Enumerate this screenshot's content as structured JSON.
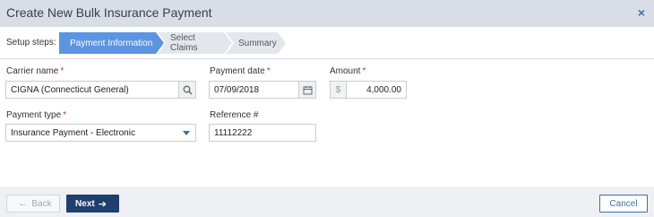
{
  "dialog": {
    "title": "Create New Bulk Insurance Payment",
    "close_glyph": "×"
  },
  "steps": {
    "label": "Setup steps:",
    "items": [
      {
        "label": "Payment Information",
        "state": "active"
      },
      {
        "label": "Select Claims",
        "state": "inactive"
      },
      {
        "label": "Summary",
        "state": "inactive"
      }
    ]
  },
  "form": {
    "carrier": {
      "label": "Carrier name",
      "required_mark": "*",
      "value": "CIGNA (Connecticut General)",
      "icon": "search-icon"
    },
    "payment_date": {
      "label": "Payment date",
      "required_mark": "*",
      "value": "07/09/2018",
      "icon": "calendar-icon"
    },
    "amount": {
      "label": "Amount",
      "required_mark": "*",
      "prefix": "$",
      "value": "4,000.00"
    },
    "payment_type": {
      "label": "Payment type",
      "required_mark": "*",
      "value": "Insurance Payment - Electronic",
      "icon": "chevron-down-icon"
    },
    "reference": {
      "label": "Reference #",
      "value": "11112222"
    }
  },
  "footer": {
    "back_label": "Back",
    "back_glyph": "←",
    "next_label": "Next",
    "next_glyph": "➔",
    "cancel_label": "Cancel"
  },
  "colors": {
    "header_bg": "#d9dee6",
    "active_step": "#5b94e1",
    "primary_button": "#1f3f6e",
    "link_blue": "#3d6fa8",
    "required": "#c0392b"
  }
}
